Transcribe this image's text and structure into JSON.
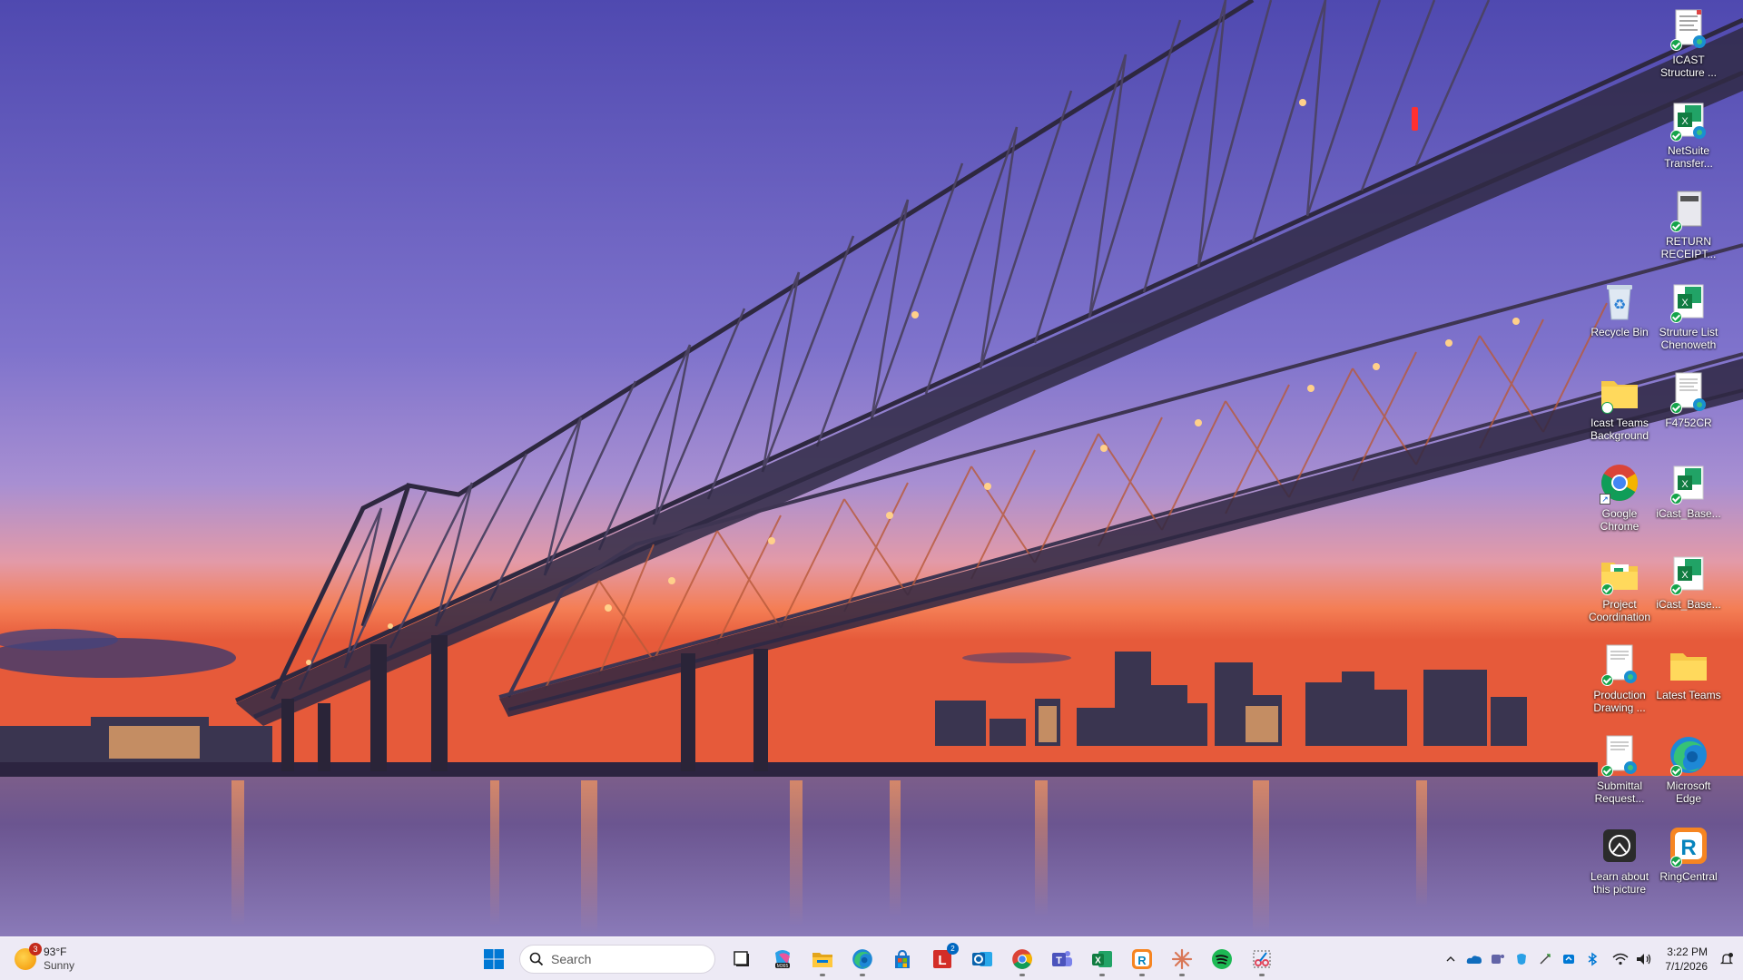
{
  "desktop": {
    "icons": [
      {
        "id": "icast-structure",
        "label": "ICAST Structure ...",
        "type": "document-edge"
      },
      {
        "id": "netsuite-transfer",
        "label": "NetSuite Transfer...",
        "type": "excel"
      },
      {
        "id": "return-receipt",
        "label": "RETURN RECEIPT...",
        "type": "pdf"
      },
      {
        "id": "recycle-bin",
        "label": "Recycle Bin",
        "type": "recycle"
      },
      {
        "id": "struture-list",
        "label": "Struture List Chenoweth",
        "type": "excel"
      },
      {
        "id": "icast-teams-bg",
        "label": "Icast Teams Background",
        "type": "folder"
      },
      {
        "id": "f4752cr",
        "label": "F4752CR",
        "type": "document-edge"
      },
      {
        "id": "google-chrome",
        "label": "Google Chrome",
        "type": "chrome"
      },
      {
        "id": "icast-base-1",
        "label": "iCast_Base...",
        "type": "excel"
      },
      {
        "id": "project-coordination",
        "label": "Project Coordination",
        "type": "folder-doc"
      },
      {
        "id": "icast-base-2",
        "label": "iCast_Base...",
        "type": "excel"
      },
      {
        "id": "production-drawing",
        "label": "Production Drawing ...",
        "type": "document-edge"
      },
      {
        "id": "latest-teams",
        "label": "Latest Teams",
        "type": "folder"
      },
      {
        "id": "submittal-request",
        "label": "Submittal Request...",
        "type": "document-edge"
      },
      {
        "id": "microsoft-edge",
        "label": "Microsoft Edge",
        "type": "edge"
      },
      {
        "id": "learn-about-picture",
        "label": "Learn about this picture",
        "type": "spotlight"
      },
      {
        "id": "ringcentral",
        "label": "RingCentral",
        "type": "ringcentral"
      }
    ]
  },
  "taskbar": {
    "weather": {
      "temp": "93°F",
      "condition": "Sunny",
      "badge": "3"
    },
    "search": {
      "placeholder": "Search"
    },
    "apps": [
      {
        "id": "start",
        "icon": "windows-logo"
      },
      {
        "id": "task-view",
        "icon": "task-view-icon"
      },
      {
        "id": "copilot",
        "icon": "copilot-icon"
      },
      {
        "id": "file-explorer",
        "icon": "folder-icon"
      },
      {
        "id": "edge",
        "icon": "edge-icon"
      },
      {
        "id": "store",
        "icon": "store-icon"
      },
      {
        "id": "lastpass",
        "icon": "lastpass-icon",
        "badge": "2"
      },
      {
        "id": "outlook",
        "icon": "outlook-icon"
      },
      {
        "id": "chrome",
        "icon": "chrome-icon"
      },
      {
        "id": "teams",
        "icon": "teams-icon"
      },
      {
        "id": "excel",
        "icon": "excel-icon"
      },
      {
        "id": "ringcentral",
        "icon": "ringcentral-icon"
      },
      {
        "id": "claude",
        "icon": "sparkle-icon"
      },
      {
        "id": "spotify",
        "icon": "spotify-icon"
      },
      {
        "id": "snipping",
        "icon": "snipping-tool-icon"
      }
    ],
    "tray": {
      "time": "3:22 PM",
      "date": "7/1/2026"
    }
  },
  "colors": {
    "sky_top": "#5b55b8",
    "sky_mid": "#8a7ad0",
    "sunset": "#f07a4a",
    "water": "#3b2f5e",
    "taskbar": "#ece8f4",
    "accent": "#0067c0"
  }
}
